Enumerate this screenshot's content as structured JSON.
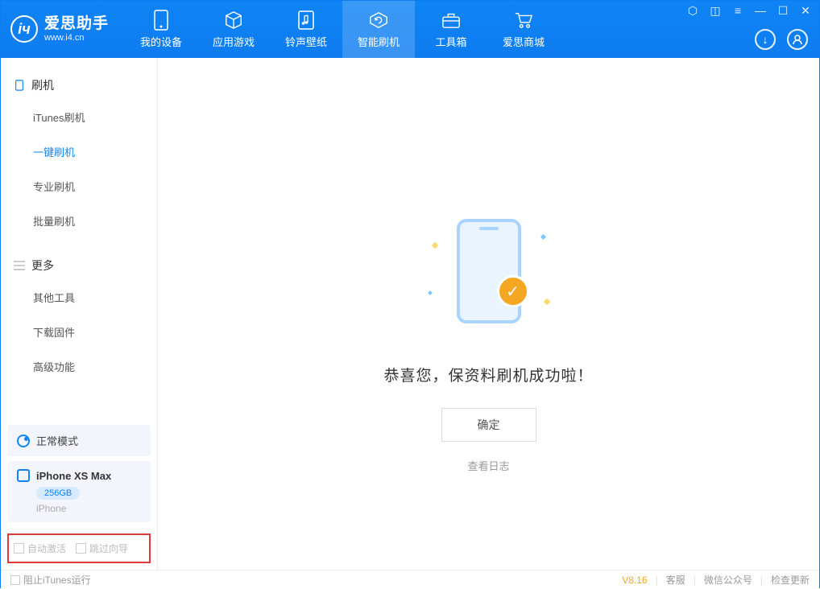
{
  "app": {
    "title": "爱思助手",
    "subtitle": "www.i4.cn"
  },
  "nav": {
    "items": [
      {
        "label": "我的设备",
        "icon": "device"
      },
      {
        "label": "应用游戏",
        "icon": "cube"
      },
      {
        "label": "铃声壁纸",
        "icon": "music"
      },
      {
        "label": "智能刷机",
        "icon": "refresh"
      },
      {
        "label": "工具箱",
        "icon": "toolbox"
      },
      {
        "label": "爱思商城",
        "icon": "cart"
      }
    ],
    "active_index": 3
  },
  "sidebar": {
    "section1_title": "刷机",
    "section1_items": [
      "iTunes刷机",
      "一键刷机",
      "专业刷机",
      "批量刷机"
    ],
    "section1_active_index": 1,
    "section2_title": "更多",
    "section2_items": [
      "其他工具",
      "下载固件",
      "高级功能"
    ],
    "mode_label": "正常模式",
    "device": {
      "name": "iPhone XS Max",
      "storage": "256GB",
      "type": "iPhone"
    },
    "options": {
      "auto_activate": "自动激活",
      "skip_guide": "跳过向导"
    }
  },
  "main": {
    "success_message": "恭喜您，保资料刷机成功啦！",
    "ok_button": "确定",
    "view_log": "查看日志"
  },
  "statusbar": {
    "block_itunes": "阻止iTunes运行",
    "version": "V8.16",
    "links": [
      "客服",
      "微信公众号",
      "检查更新"
    ]
  }
}
